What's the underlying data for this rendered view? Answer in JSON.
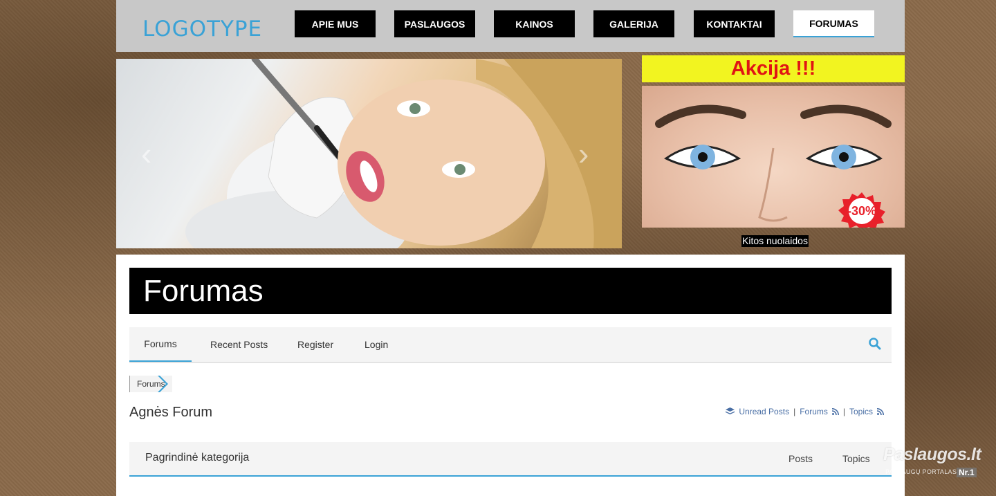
{
  "header": {
    "logo": "LOGOTYPE",
    "nav": [
      {
        "label": "APIE MUS"
      },
      {
        "label": "PASLAUGOS"
      },
      {
        "label": "KAINOS"
      },
      {
        "label": "GALERIJA"
      },
      {
        "label": "KONTAKTAI"
      },
      {
        "label": "FORUMAS",
        "active": true
      }
    ]
  },
  "banner": {
    "prev_icon": "chevron-left-icon",
    "next_icon": "chevron-right-icon"
  },
  "promo": {
    "title": "Akcija !!!",
    "badge": "-30%",
    "link": "Kitos nuolaidos"
  },
  "forum": {
    "page_title": "Forumas",
    "nav": [
      {
        "label": "Forums",
        "active": true
      },
      {
        "label": "Recent Posts"
      },
      {
        "label": "Register"
      },
      {
        "label": "Login"
      }
    ],
    "search_icon": "search-icon",
    "breadcrumb": "Forums",
    "name": "Agnės Forum",
    "quick_links": {
      "unread": "Unread Posts",
      "forums": "Forums",
      "topics": "Topics"
    },
    "category": {
      "title": "Pagrindinė kategorija",
      "col_posts": "Posts",
      "col_topics": "Topics"
    }
  },
  "watermark": {
    "main": "Paslaugos.lt",
    "sub": "PASLAUGŲ PORTALAS",
    "rank": "Nr.1"
  },
  "colors": {
    "accent": "#3aa2d6",
    "promo_bg": "#f2f420",
    "promo_text": "#e01414"
  }
}
